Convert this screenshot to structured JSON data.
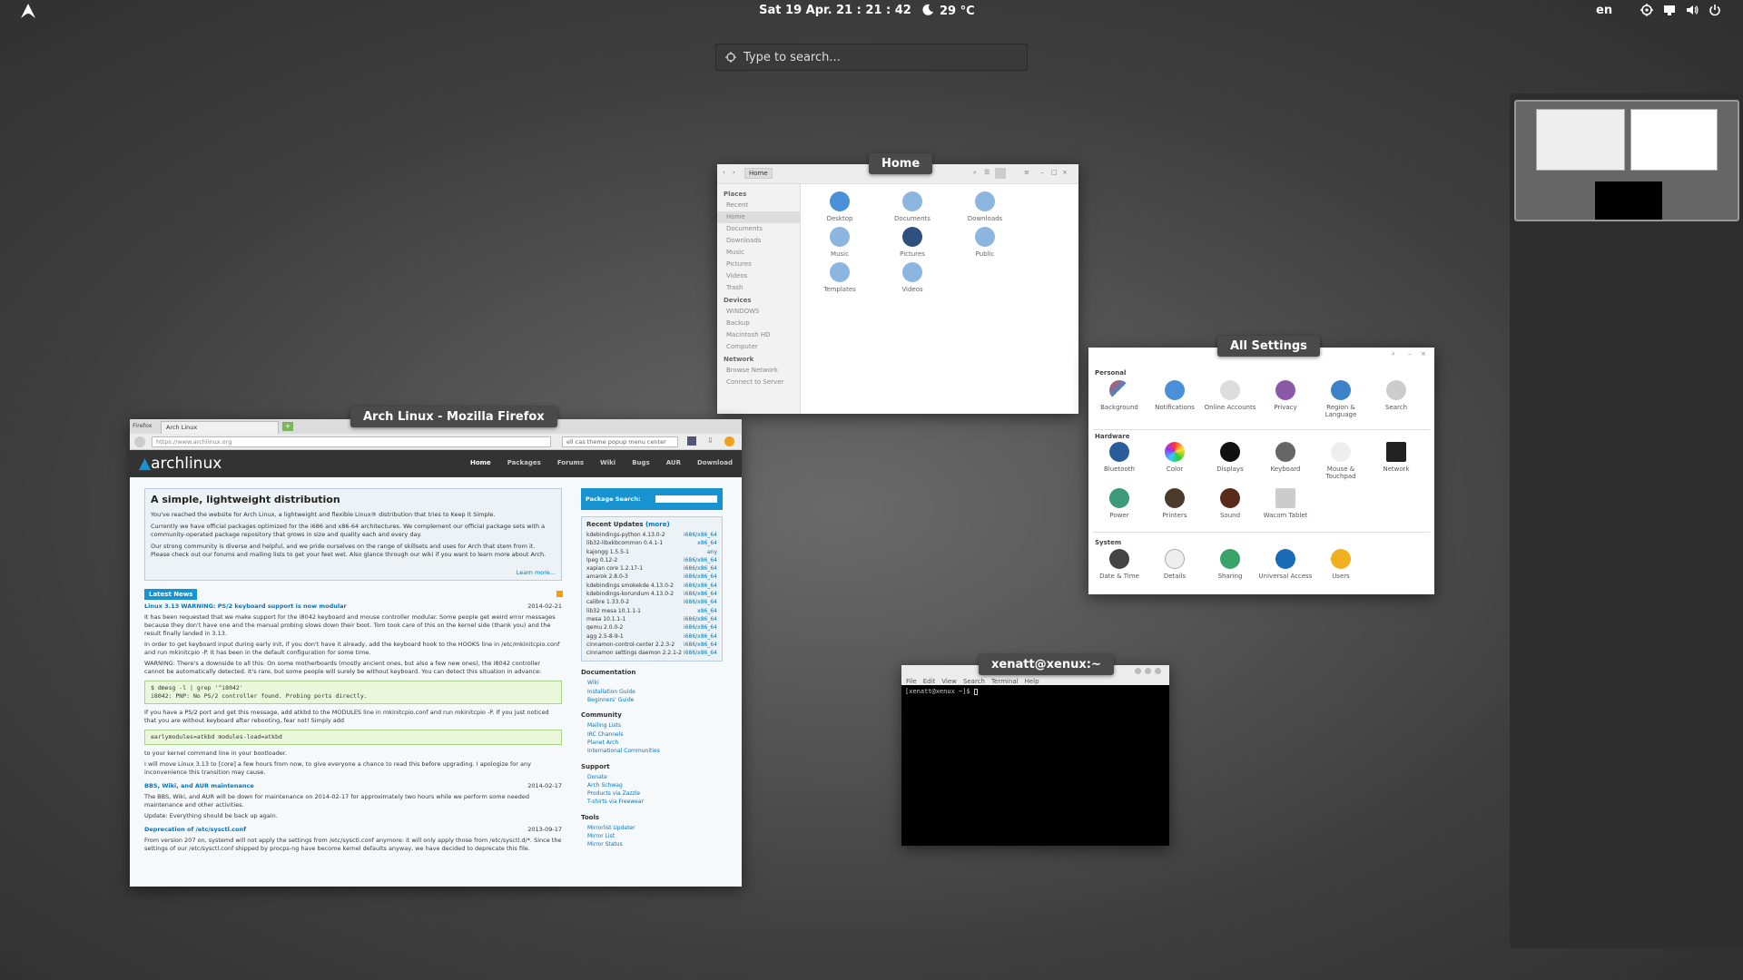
{
  "topbar": {
    "clock": "Sat 19 Apr. 21 : 21 : 42",
    "weather": "29 °C",
    "lang": "en"
  },
  "search": {
    "placeholder": "Type to search..."
  },
  "window_labels": {
    "files": "Home",
    "settings": "All Settings",
    "terminal": "xenatt@xenux:~",
    "firefox": "Arch Linux - Mozilla Firefox"
  },
  "files": {
    "path": "Home",
    "sections": {
      "places": "Places",
      "devices": "Devices",
      "network": "Network"
    },
    "places": [
      "Recent",
      "Home",
      "Documents",
      "Downloads",
      "Music",
      "Pictures",
      "Videos",
      "Trash"
    ],
    "devices": [
      "WINDOWS",
      "Backup",
      "Macintosh HD",
      "Computer"
    ],
    "network": [
      "Browse Network",
      "Connect to Server"
    ],
    "folders": [
      "Desktop",
      "Documents",
      "Downloads",
      "Music",
      "Pictures",
      "Public",
      "Templates",
      "Videos"
    ]
  },
  "settings": {
    "sections": {
      "personal": "Personal",
      "hardware": "Hardware",
      "system": "System"
    },
    "personal": [
      "Background",
      "Notifications",
      "Online Accounts",
      "Privacy",
      "Region & Language",
      "Search"
    ],
    "hardware": [
      "Bluetooth",
      "Color",
      "Displays",
      "Keyboard",
      "Mouse & Touchpad",
      "Network",
      "Power",
      "Printers",
      "Sound",
      "Wacom Tablet"
    ],
    "system": [
      "Date & Time",
      "Details",
      "Sharing",
      "Universal Access",
      "Users"
    ]
  },
  "terminal": {
    "menu": [
      "File",
      "Edit",
      "View",
      "Search",
      "Terminal",
      "Help"
    ],
    "prompt": "[xenatt@xenux ~]$ "
  },
  "firefox": {
    "tab_menu": "Firefox",
    "tab_title": "Arch Linux",
    "url": "https://www.archlinux.org",
    "search_value": "ell cas theme popup menu center",
    "site_logo": "archlinux",
    "nav_links": [
      "Home",
      "Packages",
      "Forums",
      "Wiki",
      "Bugs",
      "AUR",
      "Download"
    ],
    "intro_title": "A simple, lightweight distribution",
    "intro_p1": "You've reached the website for Arch Linux, a lightweight and flexible Linux® distribution that tries to Keep It Simple.",
    "intro_p2": "Currently we have official packages optimized for the i686 and x86-64 architectures. We complement our official package sets with a community-operated package repository that grows in size and quality each and every day.",
    "intro_p3": "Our strong community is diverse and helpful, and we pride ourselves on the range of skillsets and uses for Arch that stem from it. Please check out our forums and mailing lists to get your feet wet. Also glance through our wiki if you want to learn more about Arch.",
    "learn_more": "Learn more...",
    "latest_news": "Latest News",
    "news1_title": "Linux 3.13 WARNING: PS/2 keyboard support is now modular",
    "news1_date": "2014-02-21",
    "news1_p1": "It has been requested that we make support for the i8042 keyboard and mouse controller modular. Some people get weird error messages because they don't have one and the manual probing slows down their boot. Tom took care of this on the kernel side (thank you) and the result finally landed in 3.13.",
    "news1_p2": "In order to get keyboard input during early init, if you don't have it already, add the keyboard hook to the HOOKS line in /etc/mkinitcpio.conf and run mkinitcpio -P. It has been in the default configuration for some time.",
    "news1_p3": "WARNING: There's a downside to all this: On some motherboards (mostly ancient ones, but also a few new ones), the i8042 controller cannot be automatically detected. It's rare, but some people will surely be without keyboard. You can detect this situation in advance:",
    "code1_l1": "$ dmesg -l | grep '^i8042'",
    "code1_l2": "i8042: PNP: No PS/2 controller found. Probing ports directly.",
    "news1_p4": "If you have a PS/2 port and get this message, add atkbd to the MODULES line in mkinitcpio.conf and run mkinitcpio -P. If you just noticed that you are without keyboard after rebooting, fear not! Simply add",
    "code2": "earlymodules=atkbd modules-load=atkbd",
    "news1_p5": "to your kernel command line in your bootloader.",
    "news1_p6": "I will move Linux 3.13 to [core] a few hours from now, to give everyone a chance to read this before upgrading. I apologize for any inconvenience this transition may cause.",
    "news2_title": "BBS, Wiki, and AUR maintenance",
    "news2_date": "2014-02-17",
    "news2_p1": "The BBS, Wiki, and AUR will be down for maintenance on 2014-02-17 for approximately two hours while we perform some needed maintenance and other activities.",
    "news2_p2": "Update: Everything should be back up again.",
    "news3_title": "Deprecation of /etc/sysctl.conf",
    "news3_date": "2013-09-17",
    "news3_p1": "From version 207 on, systemd will not apply the settings from /etc/sysctl.conf anymore: it will only apply those from /etc/sysctl.d/*. Since the settings of our /etc/sysctl.conf shipped by procps-ng have become kernel defaults anyway, we have decided to deprecate this file.",
    "pkg_search": "Package Search:",
    "recent_updates": "Recent Updates",
    "more": "(more)",
    "updates": [
      {
        "name": "kdebindings-python 4.13.0-2",
        "arch": "i686/x86_64"
      },
      {
        "name": "lib32-libxkbcommon 0.4.1-1",
        "arch": "x86_64"
      },
      {
        "name": "kajongg 1.5.5-1",
        "arch": "any"
      },
      {
        "name": "lpeg 0.12-2",
        "arch": "i686/x86_64"
      },
      {
        "name": "xapian core 1.2.17-1",
        "arch": "i686/x86_64"
      },
      {
        "name": "amarok 2.8.0-3",
        "arch": "i686/x86_64"
      },
      {
        "name": "kdebindings smokekde 4.13.0-2",
        "arch": "i686/x86_64"
      },
      {
        "name": "kdebindings-korundum 4.13.0-2",
        "arch": "i686/x86_64"
      },
      {
        "name": "calibre 1.33.0-2",
        "arch": "i686/x86_64"
      },
      {
        "name": "lib32 mesa 10.1.1-1",
        "arch": "x86_64"
      },
      {
        "name": "mesa 10.1.1-1",
        "arch": "i686/x86_64"
      },
      {
        "name": "qemu 2.0.0-2",
        "arch": "i686/x86_64"
      },
      {
        "name": "agg 2.5-8-9-1",
        "arch": "i686/x86_64"
      },
      {
        "name": "cinnamon-control-center 2.2.3-2",
        "arch": "i686/x86_64"
      },
      {
        "name": "cinnamon settings daemon 2.2.1-2",
        "arch": "i686/x86_64"
      }
    ],
    "documentation": "Documentation",
    "doc_links": [
      "Wiki",
      "Installation Guide",
      "Beginners' Guide"
    ],
    "community": "Community",
    "community_links": [
      "Mailing Lists",
      "IRC Channels",
      "Planet Arch",
      "International Communities"
    ],
    "support": "Support",
    "support_links": [
      "Donate",
      "Arch Schwag",
      "Products via Zazzle",
      "T-shirts via Freewear"
    ],
    "tools": "Tools",
    "tools_links": [
      "Mirrorlist Updater",
      "Mirror List",
      "Mirror Status"
    ]
  },
  "colors": {
    "arch_blue": "#1793d1",
    "folder_blue": "#8cb6e0",
    "desktop_bg": "#4a4a4a"
  }
}
